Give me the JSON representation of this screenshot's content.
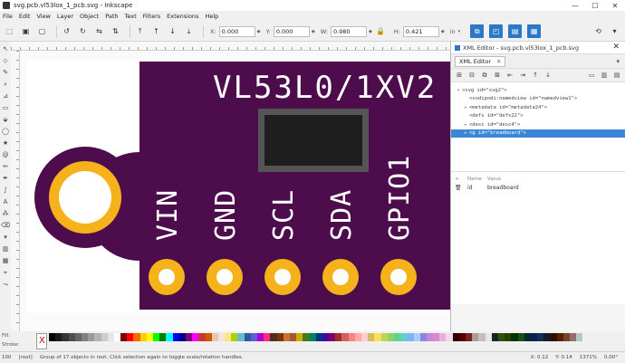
{
  "window": {
    "title": "svg.pcb.vl53lox_1_pcb.svg - Inkscape",
    "minimize": "—",
    "maximize": "☐",
    "close": "✕"
  },
  "menu": [
    "File",
    "Edit",
    "View",
    "Layer",
    "Object",
    "Path",
    "Text",
    "Filters",
    "Extensions",
    "Help"
  ],
  "toolbar": {
    "x_label": "X:",
    "x_value": "0.000",
    "y_label": "Y:",
    "y_value": "0.000",
    "w_label": "W:",
    "w_value": "0.980",
    "h_label": "H:",
    "h_value": "0.421",
    "unit": "in"
  },
  "board": {
    "model": "VL53L0/1XV2",
    "pins": [
      "VIN",
      "GND",
      "SCL",
      "SDA",
      "GPIO1"
    ],
    "colors": {
      "board": "#4d0d4d",
      "pad": "#f5b21a",
      "white": "#ffffff",
      "chip": "#1e1e1e",
      "chip_border": "#555555"
    }
  },
  "xml_editor": {
    "window_title": "XML Editor - svg.pcb.vl53lox_1_pcb.svg",
    "tab_label": "XML Editor",
    "nodes": [
      {
        "text": "<svg id=\"svg2\">",
        "arrow": "▾",
        "indent": 0,
        "selected": false
      },
      {
        "text": "<sodipodi:namedview id=\"namedview1\">",
        "arrow": "",
        "indent": 1,
        "selected": false
      },
      {
        "text": "<metadata id=\"metadata24\">",
        "arrow": "▸",
        "indent": 1,
        "selected": false
      },
      {
        "text": "<defs id=\"defs22\">",
        "arrow": "",
        "indent": 1,
        "selected": false
      },
      {
        "text": "<desc id=\"desc4\">",
        "arrow": "▸",
        "indent": 1,
        "selected": false
      },
      {
        "text": "<g id=\"breadboard\">",
        "arrow": "▸",
        "indent": 1,
        "selected": true
      }
    ],
    "attr_header": {
      "name": "Name",
      "value": "Value"
    },
    "attributes": [
      {
        "name": "id",
        "value": "breadboard"
      }
    ]
  },
  "palette": {
    "fill_label": "Fill:",
    "stroke_label": "Stroke:",
    "none_label": "X",
    "colors": [
      "#000000",
      "#1a1a1a",
      "#333333",
      "#4d4d4d",
      "#666666",
      "#808080",
      "#999999",
      "#b3b3b3",
      "#cccccc",
      "#e6e6e6",
      "#ffffff",
      "#800000",
      "#ff0000",
      "#ff6600",
      "#ffcc00",
      "#ffff00",
      "#00ff00",
      "#008000",
      "#00ffff",
      "#0000ff",
      "#000080",
      "#800080",
      "#ff00ff",
      "#c83737",
      "#d45500",
      "#e9c6af",
      "#f4e3d7",
      "#ffe680",
      "#aad400",
      "#5fbcd3",
      "#2c5aa0",
      "#5f5fd3",
      "#aa00d4",
      "#ff2a7f",
      "#502d16",
      "#803300",
      "#c87137",
      "#a05a2c",
      "#d4aa00",
      "#447821",
      "#008066",
      "#003380",
      "#4400aa",
      "#800066",
      "#a02c2c",
      "#d35f5f",
      "#ff8080",
      "#ffaaaa",
      "#ffcccc",
      "#d3bc5f",
      "#ffdd55",
      "#bcd35f",
      "#8dd35f",
      "#5fd38d",
      "#5fd3bc",
      "#80b3ff",
      "#aaccff",
      "#8787de",
      "#c287de",
      "#de87cd",
      "#e9afdd",
      "#f4d7ee",
      "#2b0000",
      "#550000",
      "#782121",
      "#ac9d93",
      "#c8beb7",
      "#e6e6e6",
      "#1c241c",
      "#2d5016",
      "#224400",
      "#003300",
      "#165016",
      "#0b2828",
      "#002255",
      "#162d50",
      "#1a1a2e",
      "#2b1100",
      "#552200",
      "#784421",
      "#916f6f",
      "#b7c8be"
    ]
  },
  "status": {
    "opacity": "100",
    "layer": "[root]",
    "message": "Group of 17 objects in root. Click selection again to toggle scale/rotation handles.",
    "x": "X: 0.12",
    "y": "Y: 0.14",
    "zoom": "1371%",
    "rotation": "0.00°"
  }
}
